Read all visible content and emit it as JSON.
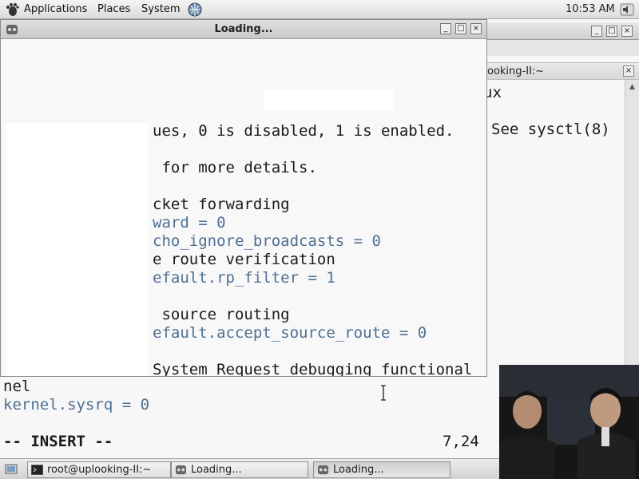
{
  "top_panel": {
    "menus": [
      "Applications",
      "Places",
      "System"
    ],
    "clock": "10:53 AM"
  },
  "terminal": {
    "tab_title": "ooking-II:~",
    "lines_right": [
      {
        "text": "ux",
        "color": "plain"
      },
      {
        "text": "See sysctl(8)",
        "color": "plain"
      }
    ],
    "lines_bottom": [
      {
        "text": "nel",
        "color": "plain"
      },
      {
        "text": "kernel.sysrq = 0",
        "color": "blue"
      }
    ],
    "mode": "-- INSERT --",
    "cursor_pos": "7,24"
  },
  "loading_window": {
    "title": "Loading...",
    "lines": [
      {
        "text": "ues, 0 is disabled, 1 is enabled.",
        "color": "plain"
      },
      {
        "text": "",
        "color": "plain"
      },
      {
        "text": " for more details.",
        "color": "plain"
      },
      {
        "text": "",
        "color": "plain"
      },
      {
        "text": "cket forwarding",
        "color": "plain"
      },
      {
        "text": "ward = 0",
        "color": "blue"
      },
      {
        "text": "cho_ignore_broadcasts = 0",
        "color": "blue"
      },
      {
        "text": "e route verification",
        "color": "plain"
      },
      {
        "text": "efault.rp_filter = 1",
        "color": "blue"
      },
      {
        "text": "",
        "color": "plain"
      },
      {
        "text": " source routing",
        "color": "plain"
      },
      {
        "text": "efault.accept_source_route = 0",
        "color": "blue"
      },
      {
        "text": "",
        "color": "plain"
      },
      {
        "text": "System Request debugging functional",
        "color": "plain"
      }
    ]
  },
  "taskbar": {
    "tasks": [
      {
        "label": "root@uplooking-II:~",
        "active": false
      },
      {
        "label": "Loading...",
        "active": false
      },
      {
        "label": "Loading...",
        "active": true
      }
    ]
  }
}
